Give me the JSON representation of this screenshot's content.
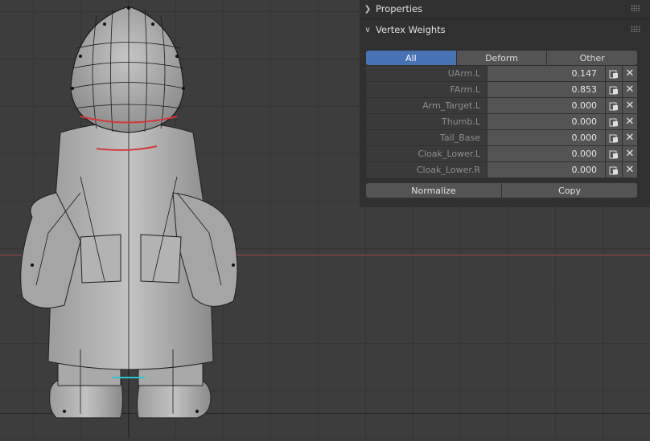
{
  "properties_panel": {
    "title": "Properties"
  },
  "vertex_weights_panel": {
    "title": "Vertex Weights",
    "tabs": [
      {
        "label": "All",
        "active": true
      },
      {
        "label": "Deform",
        "active": false
      },
      {
        "label": "Other",
        "active": false
      }
    ],
    "rows": [
      {
        "group": "UArm.L",
        "weight": "0.147"
      },
      {
        "group": "FArm.L",
        "weight": "0.853"
      },
      {
        "group": "Arm_Target.L",
        "weight": "0.000"
      },
      {
        "group": "Thumb.L",
        "weight": "0.000"
      },
      {
        "group": "Tail_Base",
        "weight": "0.000"
      },
      {
        "group": "Cloak_Lower.L",
        "weight": "0.000"
      },
      {
        "group": "Cloak_Lower.R",
        "weight": "0.000"
      }
    ],
    "actions": {
      "normalize": "Normalize",
      "copy": "Copy"
    },
    "icons": {
      "expand": "chevron-right-icon",
      "collapse": "chevron-down-icon",
      "paste": "clipboard-paste-icon",
      "delete": "x-icon",
      "drag": "drag-grip-icon"
    }
  },
  "viewport": {
    "accent_colors": {
      "active_tab": "#4772b3",
      "axis_x": "#9a4444",
      "seam": "#d23a3a",
      "selected_edge": "#2ec4d4"
    }
  }
}
